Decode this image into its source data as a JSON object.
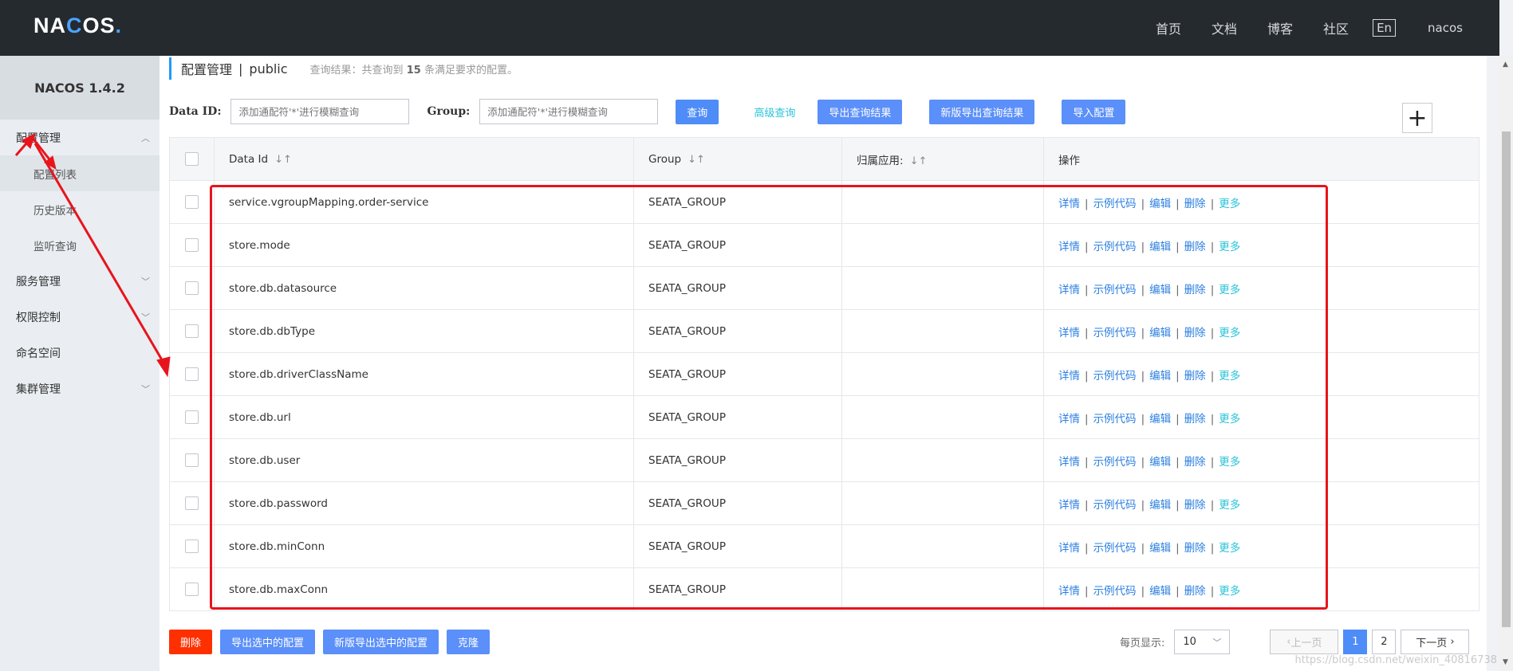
{
  "header": {
    "logo": "NACOS.",
    "nav": [
      "首页",
      "文档",
      "博客",
      "社区"
    ],
    "lang": "En",
    "user": "nacos"
  },
  "sidebar": {
    "version": "NACOS 1.4.2",
    "groups": [
      {
        "label": "配置管理",
        "expanded": true,
        "items": [
          "配置列表",
          "历史版本",
          "监听查询"
        ]
      },
      {
        "label": "服务管理",
        "expanded": false
      },
      {
        "label": "权限控制",
        "expanded": false
      },
      {
        "label": "命名空间",
        "expanded": false
      },
      {
        "label": "集群管理",
        "expanded": false
      }
    ]
  },
  "crumb": {
    "title": "配置管理",
    "sep": "|",
    "namespace": "public",
    "result_prefix": "查询结果：共查询到",
    "result_count": "15",
    "result_suffix": "条满足要求的配置。"
  },
  "search": {
    "dataid_label": "Data ID:",
    "dataid_placeholder": "添加通配符'*'进行模糊查询",
    "group_label": "Group:",
    "group_placeholder": "添加通配符'*'进行模糊查询",
    "query": "查询",
    "advanced": "高级查询",
    "export": "导出查询结果",
    "export_new": "新版导出查询结果",
    "import": "导入配置",
    "plus": "+"
  },
  "table": {
    "headers": {
      "dataid": "Data Id",
      "group": "Group",
      "app": "归属应用:",
      "ops": "操作"
    },
    "sort_icon": "↓↑",
    "rows": [
      {
        "dataid": "service.vgroupMapping.order-service",
        "group": "SEATA_GROUP",
        "app": ""
      },
      {
        "dataid": "store.mode",
        "group": "SEATA_GROUP",
        "app": ""
      },
      {
        "dataid": "store.db.datasource",
        "group": "SEATA_GROUP",
        "app": ""
      },
      {
        "dataid": "store.db.dbType",
        "group": "SEATA_GROUP",
        "app": ""
      },
      {
        "dataid": "store.db.driverClassName",
        "group": "SEATA_GROUP",
        "app": ""
      },
      {
        "dataid": "store.db.url",
        "group": "SEATA_GROUP",
        "app": ""
      },
      {
        "dataid": "store.db.user",
        "group": "SEATA_GROUP",
        "app": ""
      },
      {
        "dataid": "store.db.password",
        "group": "SEATA_GROUP",
        "app": ""
      },
      {
        "dataid": "store.db.minConn",
        "group": "SEATA_GROUP",
        "app": ""
      },
      {
        "dataid": "store.db.maxConn",
        "group": "SEATA_GROUP",
        "app": ""
      }
    ],
    "ops": {
      "detail": "详情",
      "sample": "示例代码",
      "edit": "编辑",
      "delete": "删除",
      "more": "更多",
      "bar": "|"
    }
  },
  "bottom": {
    "delete": "删除",
    "export_selected": "导出选中的配置",
    "export_selected_new": "新版导出选中的配置",
    "clone": "克隆"
  },
  "pager": {
    "per_page_label": "每页显示:",
    "per_page": "10",
    "prev": "上一页",
    "pages": [
      "1",
      "2"
    ],
    "current": "1",
    "next": "下一页"
  },
  "watermark": "https://blog.csdn.net/weixin_40816738",
  "colors": {
    "primary": "#4e8cf7",
    "danger": "#ff3000",
    "link": "#2b7fe0",
    "annotation": "#e8141c"
  }
}
